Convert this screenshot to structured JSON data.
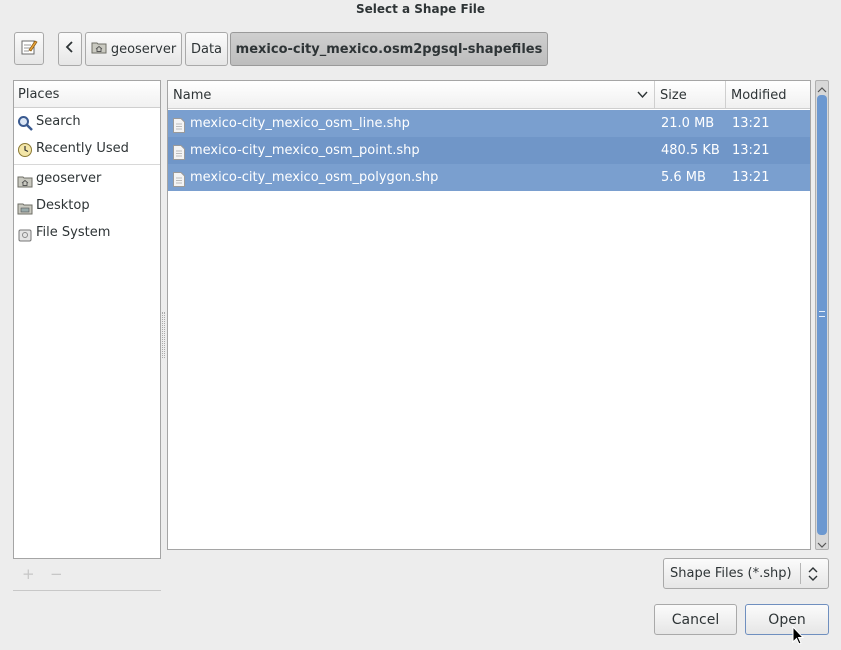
{
  "window": {
    "title": "Select a Shape File"
  },
  "toolbar": {
    "crumbs": [
      "geoserver",
      "Data",
      "mexico-city_mexico.osm2pgsql-shapefiles"
    ]
  },
  "places": {
    "header": "Places",
    "items": [
      {
        "label": "Search",
        "icon": "search-icon"
      },
      {
        "label": "Recently Used",
        "icon": "clock-icon"
      },
      {
        "label": "geoserver",
        "icon": "home-folder-icon"
      },
      {
        "label": "Desktop",
        "icon": "folder-icon"
      },
      {
        "label": "File System",
        "icon": "drive-icon"
      }
    ],
    "add_label": "+",
    "remove_label": "−"
  },
  "files": {
    "columns": [
      "Name",
      "Size",
      "Modified"
    ],
    "rows": [
      {
        "name": "mexico-city_mexico_osm_line.shp",
        "size": "21.0 MB",
        "modified": "13:21"
      },
      {
        "name": "mexico-city_mexico_osm_point.shp",
        "size": "480.5 KB",
        "modified": "13:21"
      },
      {
        "name": "mexico-city_mexico_osm_polygon.shp",
        "size": "5.6 MB",
        "modified": "13:21"
      }
    ]
  },
  "filter": {
    "selected": "Shape Files (*.shp)"
  },
  "actions": {
    "cancel": "Cancel",
    "open": "Open"
  },
  "colors": {
    "selection": "#7a9fcf",
    "scroll_thumb": "#6c98d0"
  }
}
